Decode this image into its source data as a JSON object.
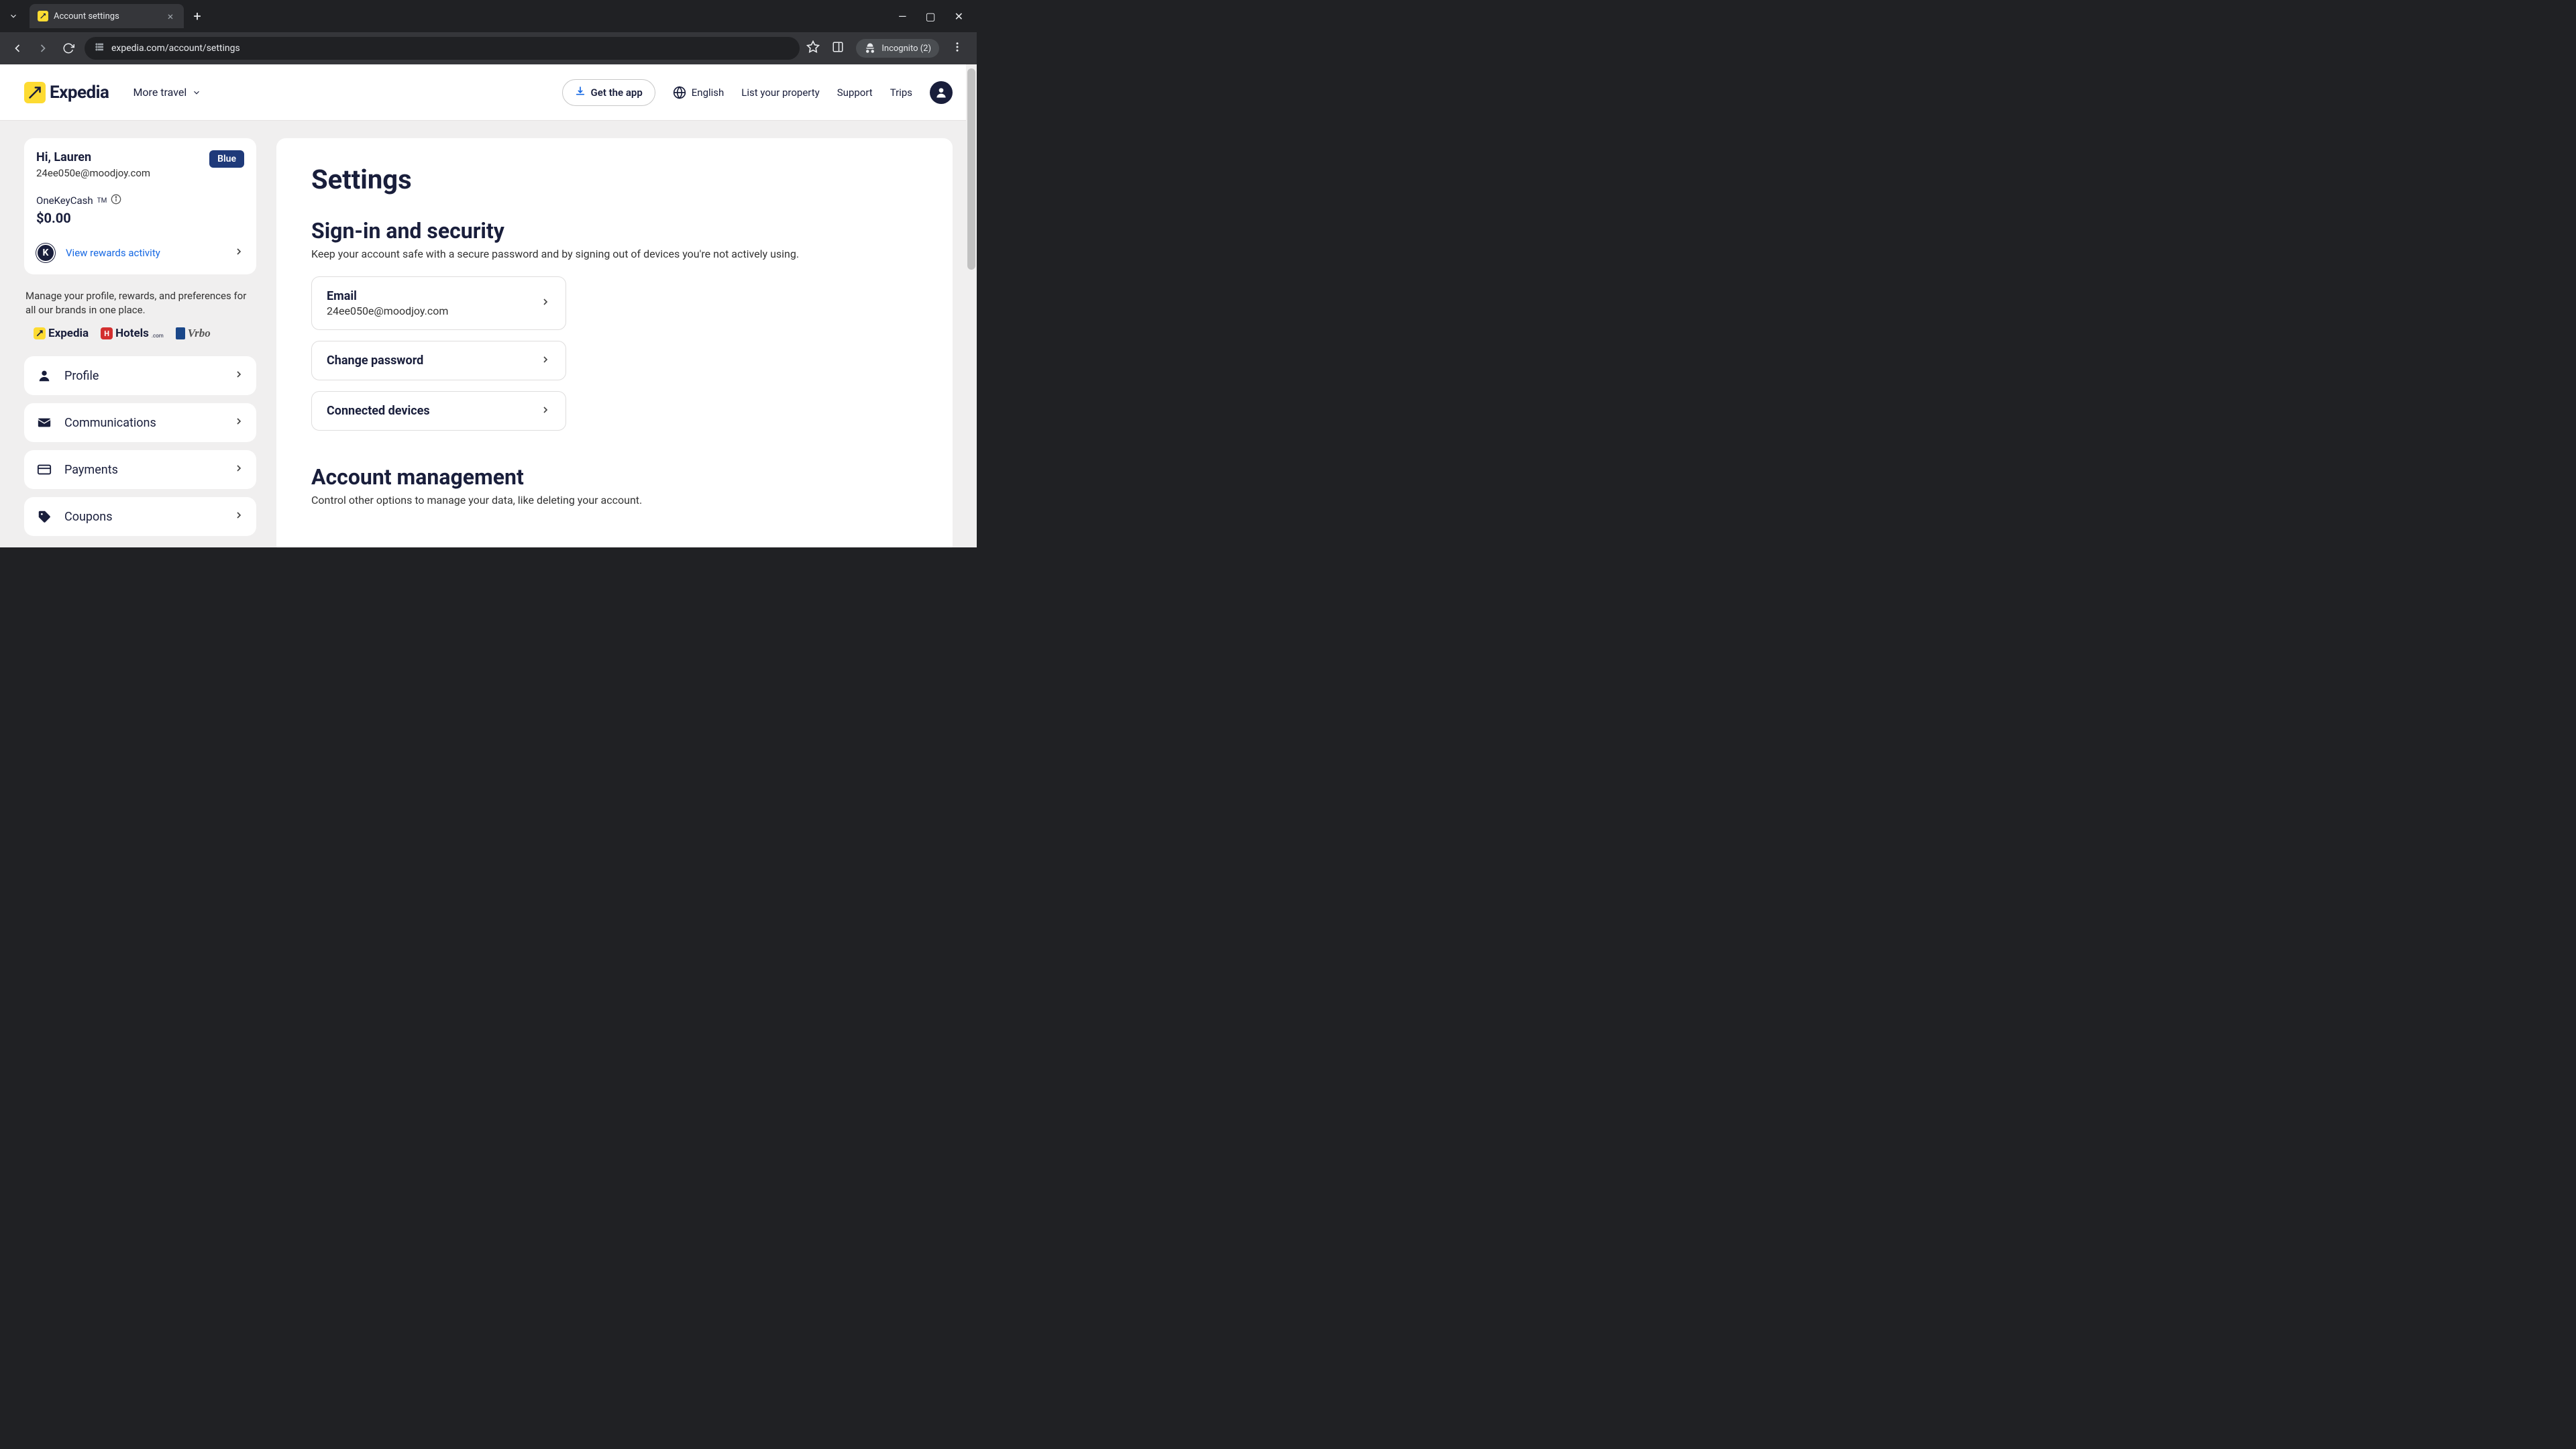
{
  "browser": {
    "tab_title": "Account settings",
    "url": "expedia.com/account/settings",
    "incognito_label": "Incognito (2)"
  },
  "header": {
    "brand": "Expedia",
    "more_travel": "More travel",
    "get_app": "Get the app",
    "language": "English",
    "list_property": "List your property",
    "support": "Support",
    "trips": "Trips"
  },
  "sidebar": {
    "greeting": "Hi, Lauren",
    "email": "24ee050e@moodjoy.com",
    "tier": "Blue",
    "cash_label": "OneKeyCash",
    "cash_tm": "TM",
    "cash_amount": "$0.00",
    "rewards_link": "View rewards activity",
    "manage_text": "Manage your profile, rewards, and preferences for all our brands in one place.",
    "brands": {
      "expedia": "Expedia",
      "hotels": "Hotels",
      "hotels_suffix": ".com",
      "vrbo": "Vrbo"
    },
    "nav": [
      {
        "id": "profile",
        "label": "Profile",
        "icon": "person"
      },
      {
        "id": "communications",
        "label": "Communications",
        "icon": "mail"
      },
      {
        "id": "payments",
        "label": "Payments",
        "icon": "card"
      },
      {
        "id": "coupons",
        "label": "Coupons",
        "icon": "tag"
      }
    ]
  },
  "main": {
    "title": "Settings",
    "section1": {
      "title": "Sign-in and security",
      "desc": "Keep your account safe with a secure password and by signing out of devices you're not actively using.",
      "items": [
        {
          "label": "Email",
          "value": "24ee050e@moodjoy.com"
        },
        {
          "label": "Change password",
          "value": ""
        },
        {
          "label": "Connected devices",
          "value": ""
        }
      ]
    },
    "section2": {
      "title": "Account management",
      "desc": "Control other options to manage your data, like deleting your account."
    }
  }
}
